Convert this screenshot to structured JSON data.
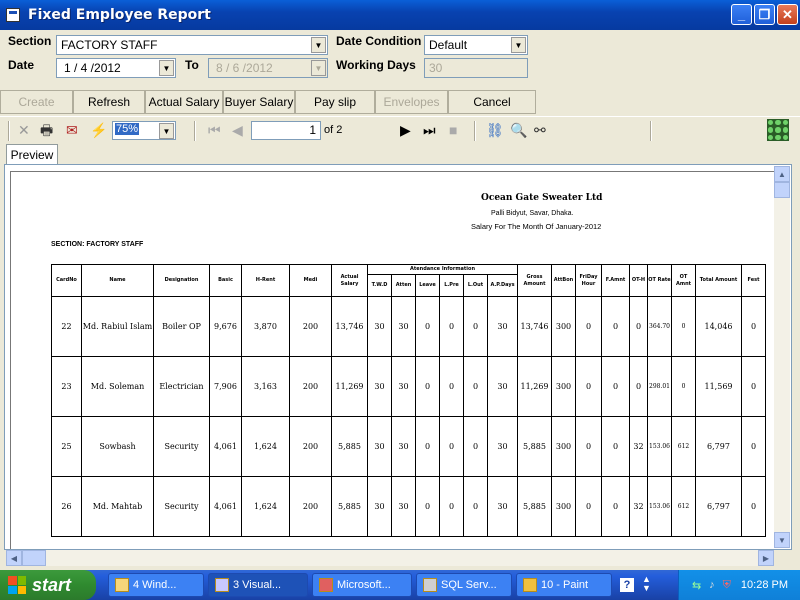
{
  "window": {
    "title": "Fixed Employee Report"
  },
  "form": {
    "section_label": "Section",
    "section_value": "FACTORY STAFF",
    "date_condition_label": "Date Condition",
    "date_condition_value": "Default",
    "date_label": "Date",
    "date_from": "1 / 4 /2012",
    "to_label": "To",
    "date_to": "8 / 6 /2012",
    "working_days_label": "Working Days",
    "working_days_value": "30"
  },
  "buttons": {
    "create": "Create",
    "refresh": "Refresh",
    "actual_salary": "Actual Salary",
    "buyer_salary": "Buyer Salary",
    "pay_slip": "Pay slip",
    "envelopes": "Envelopes",
    "cancel": "Cancel"
  },
  "viewer": {
    "zoom": "75%",
    "page_current": "1",
    "page_total_text": "of 2",
    "tab_preview": "Preview"
  },
  "report": {
    "company": "Ocean Gate Sweater Ltd",
    "address": "Palli Bidyut, Savar, Dhaka.",
    "period": "Salary For The Month Of January-2012",
    "section": "SECTION: FACTORY STAFF",
    "headers": {
      "cardno": "CardNo",
      "name": "Name",
      "designation": "Designation",
      "basic": "Basic",
      "hrent": "H-Rent",
      "medi": "Medi",
      "actual_salary": "Actual Salary",
      "attendance_info": "Atendance Information",
      "twd": "T.W.D",
      "atten": "Atten",
      "leave": "Leave",
      "lpre": "L.Pre",
      "lout": "L.Out",
      "apdays": "A.P.Days",
      "gross_amount": "Gross Amount",
      "attbon": "AttBon",
      "friday_hour": "FriDay Hour",
      "famnt": "F.Amnt",
      "oth": "OT-H",
      "ot_rate": "OT Rate",
      "ot_amnt": "OT Amnt",
      "total_amount": "Total Amount",
      "fest": "Fest"
    },
    "rows": [
      {
        "card": "22",
        "name": "Md. Rabiul Islam",
        "designation": "Boiler OP",
        "basic": "9,676",
        "hrent": "3,870",
        "medi": "200",
        "actual": "13,746",
        "twd": "30",
        "atten": "30",
        "leave": "0",
        "lpre": "0",
        "lout": "0",
        "apdays": "30",
        "gross": "13,746",
        "attbon": "300",
        "fridayhr": "0",
        "famnt": "0",
        "oth": "0",
        "otrate": "364.70",
        "otamnt": "0",
        "total": "14,046",
        "fest": "0"
      },
      {
        "card": "23",
        "name": "Md. Soleman",
        "designation": "Electrician",
        "basic": "7,906",
        "hrent": "3,163",
        "medi": "200",
        "actual": "11,269",
        "twd": "30",
        "atten": "30",
        "leave": "0",
        "lpre": "0",
        "lout": "0",
        "apdays": "30",
        "gross": "11,269",
        "attbon": "300",
        "fridayhr": "0",
        "famnt": "0",
        "oth": "0",
        "otrate": "298.01",
        "otamnt": "0",
        "total": "11,569",
        "fest": "0"
      },
      {
        "card": "25",
        "name": "Sowbash",
        "designation": "Security",
        "basic": "4,061",
        "hrent": "1,624",
        "medi": "200",
        "actual": "5,885",
        "twd": "30",
        "atten": "30",
        "leave": "0",
        "lpre": "0",
        "lout": "0",
        "apdays": "30",
        "gross": "5,885",
        "attbon": "300",
        "fridayhr": "0",
        "famnt": "0",
        "oth": "32",
        "otrate": "153.06",
        "otamnt": "612",
        "total": "6,797",
        "fest": "0"
      },
      {
        "card": "26",
        "name": "Md. Mahtab",
        "designation": "Security",
        "basic": "4,061",
        "hrent": "1,624",
        "medi": "200",
        "actual": "5,885",
        "twd": "30",
        "atten": "30",
        "leave": "0",
        "lpre": "0",
        "lout": "0",
        "apdays": "30",
        "gross": "5,885",
        "attbon": "300",
        "fridayhr": "0",
        "famnt": "0",
        "oth": "32",
        "otrate": "153.06",
        "otamnt": "612",
        "total": "6,797",
        "fest": "0"
      }
    ]
  },
  "taskbar": {
    "start": "start",
    "tasks": [
      "4 Wind...",
      "3 Visual...",
      "Microsoft...",
      "SQL Serv...",
      "10 - Paint"
    ],
    "clock": "10:28 PM"
  }
}
